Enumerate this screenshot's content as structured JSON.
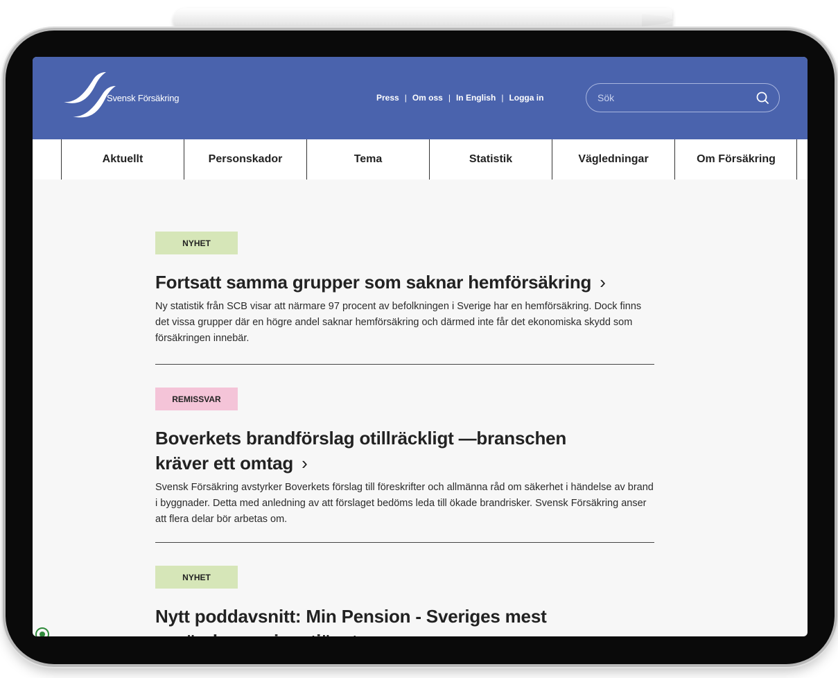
{
  "brand": {
    "name": "Svensk Försäkring"
  },
  "top_links": [
    "Press",
    "Om oss",
    "In English",
    "Logga in"
  ],
  "search": {
    "placeholder": "Sök"
  },
  "nav": [
    "Aktuellt",
    "Personskador",
    "Tema",
    "Statistik",
    "Vägledningar",
    "Om Försäkring"
  ],
  "articles": [
    {
      "tag": "NYHET",
      "title": "Fortsatt samma grupper som saknar hemförsäkring",
      "body": "Ny statistik från SCB visar att närmare 97 procent av befolkningen i Sverige har en hemförsäkring. Dock finns det vissa grupper där en högre andel saknar hemförsäkring och därmed inte får det ekonomiska skydd som försäkringen innebär."
    },
    {
      "tag": "REMISSVAR",
      "title": "Boverkets brandförslag otillräckligt —branschen kräver ett omtag",
      "body": "Svensk Försäkring avstyrker Boverkets förslag till föreskrifter och allmänna råd om säkerhet i händelse av brand i byggnader. Detta med anledning av att förslaget bedöms leda till ökade brandrisker. Svensk Försäkring anser att flera delar bör arbetas om."
    },
    {
      "tag": "NYHET",
      "title": "Nytt poddavsnitt: Min Pension - Sveriges mest använda pensionstjänst"
    }
  ],
  "colors": {
    "header": "#4a63ad",
    "tag_nyhet": "#d6e6b8",
    "tag_remissvar": "#f4c4d8"
  },
  "icons": {
    "chevron": "›",
    "search": "search-icon"
  }
}
